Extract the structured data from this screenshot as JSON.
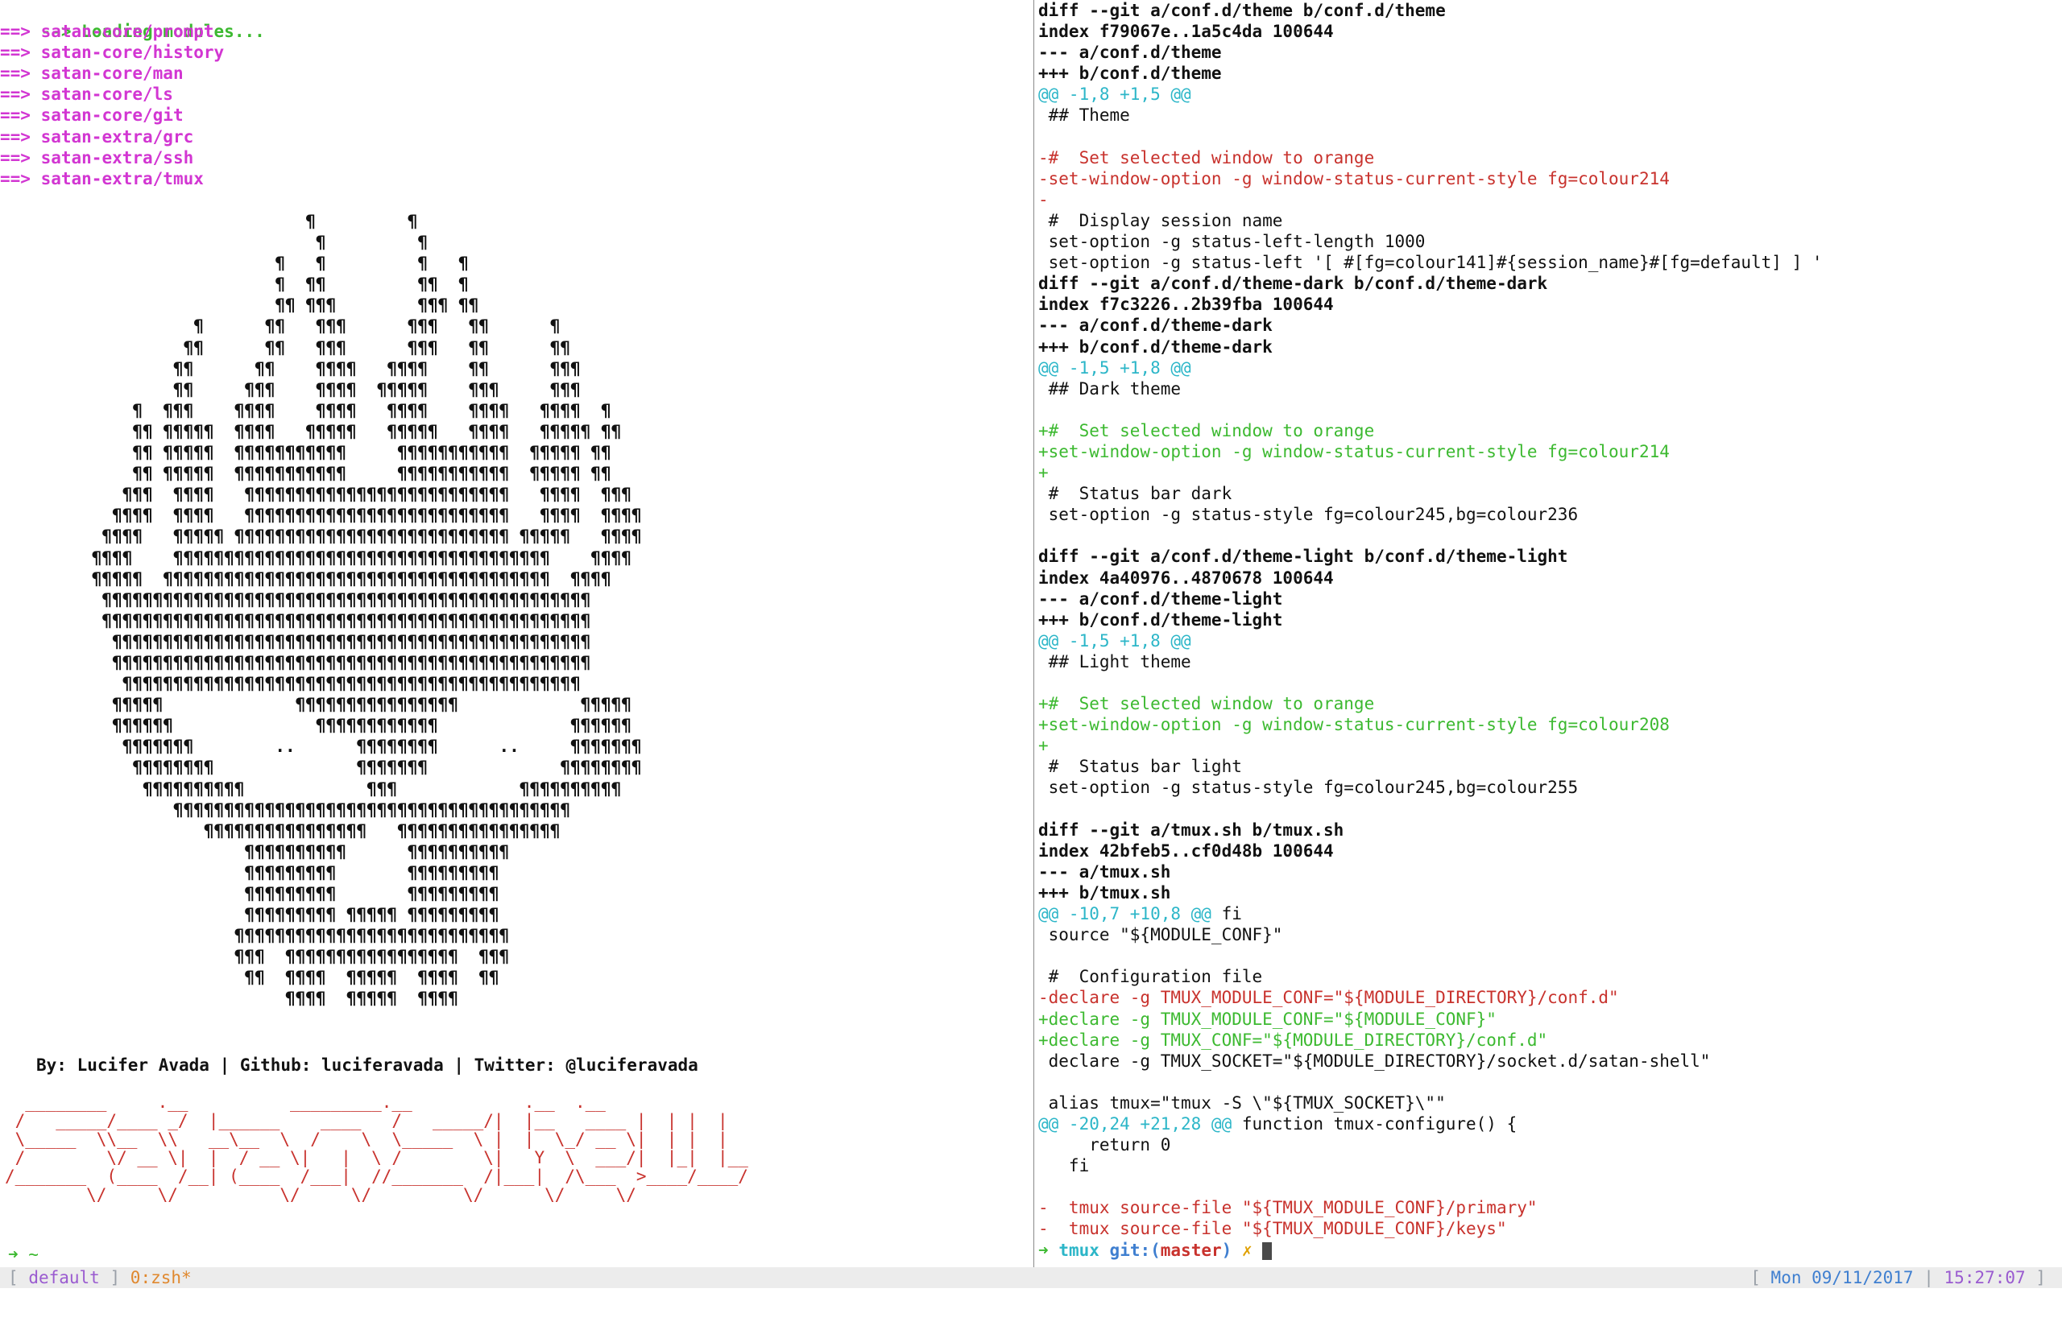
{
  "left_pane": {
    "loading": {
      "arrow": "-->",
      "text": "Loading modules..."
    },
    "modules": [
      {
        "arrow": "==>",
        "name": "satan-core/prompt"
      },
      {
        "arrow": "==>",
        "name": "satan-core/history"
      },
      {
        "arrow": "==>",
        "name": "satan-core/man"
      },
      {
        "arrow": "==>",
        "name": "satan-core/ls"
      },
      {
        "arrow": "==>",
        "name": "satan-core/git"
      },
      {
        "arrow": "==>",
        "name": "satan-extra/grc"
      },
      {
        "arrow": "==>",
        "name": "satan-extra/ssh"
      },
      {
        "arrow": "==>",
        "name": "satan-extra/tmux"
      }
    ],
    "ascii_art": [
      "                              ¶         ¶",
      "                               ¶         ¶",
      "                           ¶   ¶         ¶   ¶",
      "                           ¶  ¶¶         ¶¶  ¶",
      "                           ¶¶ ¶¶¶        ¶¶¶ ¶¶",
      "                   ¶      ¶¶   ¶¶¶      ¶¶¶   ¶¶      ¶",
      "                  ¶¶      ¶¶   ¶¶¶      ¶¶¶   ¶¶      ¶¶",
      "                 ¶¶      ¶¶    ¶¶¶¶   ¶¶¶¶    ¶¶      ¶¶¶",
      "                 ¶¶     ¶¶¶    ¶¶¶¶  ¶¶¶¶¶    ¶¶¶     ¶¶¶",
      "             ¶  ¶¶¶    ¶¶¶¶    ¶¶¶¶   ¶¶¶¶    ¶¶¶¶   ¶¶¶¶  ¶",
      "             ¶¶ ¶¶¶¶¶  ¶¶¶¶   ¶¶¶¶¶   ¶¶¶¶¶   ¶¶¶¶   ¶¶¶¶¶ ¶¶",
      "             ¶¶ ¶¶¶¶¶  ¶¶¶¶¶¶¶¶¶¶¶     ¶¶¶¶¶¶¶¶¶¶¶  ¶¶¶¶¶ ¶¶",
      "             ¶¶ ¶¶¶¶¶  ¶¶¶¶¶¶¶¶¶¶¶     ¶¶¶¶¶¶¶¶¶¶¶  ¶¶¶¶¶ ¶¶",
      "            ¶¶¶  ¶¶¶¶   ¶¶¶¶¶¶¶¶¶¶¶¶¶¶¶¶¶¶¶¶¶¶¶¶¶¶   ¶¶¶¶  ¶¶¶",
      "           ¶¶¶¶  ¶¶¶¶   ¶¶¶¶¶¶¶¶¶¶¶¶¶¶¶¶¶¶¶¶¶¶¶¶¶¶   ¶¶¶¶  ¶¶¶¶",
      "          ¶¶¶¶   ¶¶¶¶¶ ¶¶¶¶¶¶¶¶¶¶¶¶¶¶¶¶¶¶¶¶¶¶¶¶¶¶¶ ¶¶¶¶¶   ¶¶¶¶",
      "         ¶¶¶¶    ¶¶¶¶¶¶¶¶¶¶¶¶¶¶¶¶¶¶¶¶¶¶¶¶¶¶¶¶¶¶¶¶¶¶¶¶¶    ¶¶¶¶",
      "         ¶¶¶¶¶  ¶¶¶¶¶¶¶¶¶¶¶¶¶¶¶¶¶¶¶¶¶¶¶¶¶¶¶¶¶¶¶¶¶¶¶¶¶¶  ¶¶¶¶",
      "          ¶¶¶¶¶¶¶¶¶¶¶¶¶¶¶¶¶¶¶¶¶¶¶¶¶¶¶¶¶¶¶¶¶¶¶¶¶¶¶¶¶¶¶¶¶¶¶¶",
      "          ¶¶¶¶¶¶¶¶¶¶¶¶¶¶¶¶¶¶¶¶¶¶¶¶¶¶¶¶¶¶¶¶¶¶¶¶¶¶¶¶¶¶¶¶¶¶¶¶",
      "           ¶¶¶¶¶¶¶¶¶¶¶¶¶¶¶¶¶¶¶¶¶¶¶¶¶¶¶¶¶¶¶¶¶¶¶¶¶¶¶¶¶¶¶¶¶¶¶",
      "           ¶¶¶¶¶¶¶¶¶¶¶¶¶¶¶¶¶¶¶¶¶¶¶¶¶¶¶¶¶¶¶¶¶¶¶¶¶¶¶¶¶¶¶¶¶¶¶",
      "            ¶¶¶¶¶¶¶¶¶¶¶¶¶¶¶¶¶¶¶¶¶¶¶¶¶¶¶¶¶¶¶¶¶¶¶¶¶¶¶¶¶¶¶¶¶",
      "           ¶¶¶¶¶             ¶¶¶¶¶¶¶¶¶¶¶¶¶¶¶¶            ¶¶¶¶¶",
      "           ¶¶¶¶¶¶              ¶¶¶¶¶¶¶¶¶¶¶¶             ¶¶¶¶¶¶",
      "            ¶¶¶¶¶¶¶        ..      ¶¶¶¶¶¶¶¶      ..     ¶¶¶¶¶¶¶",
      "             ¶¶¶¶¶¶¶¶              ¶¶¶¶¶¶¶             ¶¶¶¶¶¶¶¶",
      "              ¶¶¶¶¶¶¶¶¶¶            ¶¶¶            ¶¶¶¶¶¶¶¶¶¶",
      "                 ¶¶¶¶¶¶¶¶¶¶¶¶¶¶¶¶¶¶¶¶¶¶¶¶¶¶¶¶¶¶¶¶¶¶¶¶¶¶¶",
      "                    ¶¶¶¶¶¶¶¶¶¶¶¶¶¶¶¶   ¶¶¶¶¶¶¶¶¶¶¶¶¶¶¶¶",
      "                        ¶¶¶¶¶¶¶¶¶¶      ¶¶¶¶¶¶¶¶¶¶",
      "                        ¶¶¶¶¶¶¶¶¶       ¶¶¶¶¶¶¶¶¶",
      "                        ¶¶¶¶¶¶¶¶¶       ¶¶¶¶¶¶¶¶¶",
      "                        ¶¶¶¶¶¶¶¶¶ ¶¶¶¶¶ ¶¶¶¶¶¶¶¶¶",
      "                       ¶¶¶¶¶¶¶¶¶¶¶¶¶¶¶¶¶¶¶¶¶¶¶¶¶¶¶",
      "                       ¶¶¶  ¶¶¶¶¶¶¶¶¶¶¶¶¶¶¶¶¶  ¶¶¶",
      "                        ¶¶  ¶¶¶¶  ¶¶¶¶¶  ¶¶¶¶  ¶¶",
      "                            ¶¶¶¶  ¶¶¶¶¶  ¶¶¶¶"
    ],
    "byline": "By: Lucifer Avada | Github: luciferavada | Twitter: @luciferavada",
    "banner": [
      "  ________     .__          _________.__           .__  .__",
      " /   _____/____ _/  |______    ____   /   _____/|  |__   ____ |  | |  |",
      " \\_____  \\\\__  \\\\   __\\__  \\  /    \\  \\_____  \\ |  |  \\_/ __ \\|  | |  |",
      " /        \\/ __ \\|  |  / __ \\|   |  \\ /        \\|   Y  \\  ___/|  |_|  |__",
      "/_______  (____  /__| (____  /___|  //_______  /|___|  /\\___  >____/____/",
      "        \\/     \\/          \\/     \\/         \\/      \\/     \\/"
    ],
    "prompt": "➜ ~"
  },
  "right_pane": {
    "diff_lines": [
      {
        "t": "diff --git a/conf.d/theme b/conf.d/theme",
        "k": "h"
      },
      {
        "t": "index f79067e..1a5c4da 100644",
        "k": "h"
      },
      {
        "t": "--- a/conf.d/theme",
        "k": "h"
      },
      {
        "t": "+++ b/conf.d/theme",
        "k": "h"
      },
      {
        "t": "@@ -1,8 +1,5 @@",
        "k": "hunk"
      },
      {
        "t": " ## Theme",
        "k": "ctx"
      },
      {
        "t": "",
        "k": "ctx"
      },
      {
        "t": "-#  Set selected window to orange",
        "k": "del"
      },
      {
        "t": "-set-window-option -g window-status-current-style fg=colour214",
        "k": "del"
      },
      {
        "t": "-",
        "k": "del"
      },
      {
        "t": " #  Display session name",
        "k": "ctx"
      },
      {
        "t": " set-option -g status-left-length 1000",
        "k": "ctx"
      },
      {
        "t": " set-option -g status-left '[ #[fg=colour141]#{session_name}#[fg=default] ] '",
        "k": "ctx"
      },
      {
        "t": "diff --git a/conf.d/theme-dark b/conf.d/theme-dark",
        "k": "h"
      },
      {
        "t": "index f7c3226..2b39fba 100644",
        "k": "h"
      },
      {
        "t": "--- a/conf.d/theme-dark",
        "k": "h"
      },
      {
        "t": "+++ b/conf.d/theme-dark",
        "k": "h"
      },
      {
        "t": "@@ -1,5 +1,8 @@",
        "k": "hunk"
      },
      {
        "t": " ## Dark theme",
        "k": "ctx"
      },
      {
        "t": "",
        "k": "ctx"
      },
      {
        "t": "+#  Set selected window to orange",
        "k": "add"
      },
      {
        "t": "+set-window-option -g window-status-current-style fg=colour214",
        "k": "add"
      },
      {
        "t": "+",
        "k": "add"
      },
      {
        "t": " #  Status bar dark",
        "k": "ctx"
      },
      {
        "t": " set-option -g status-style fg=colour245,bg=colour236",
        "k": "ctx"
      },
      {
        "t": "",
        "k": "ctx"
      },
      {
        "t": "diff --git a/conf.d/theme-light b/conf.d/theme-light",
        "k": "h"
      },
      {
        "t": "index 4a40976..4870678 100644",
        "k": "h"
      },
      {
        "t": "--- a/conf.d/theme-light",
        "k": "h"
      },
      {
        "t": "+++ b/conf.d/theme-light",
        "k": "h"
      },
      {
        "t": "@@ -1,5 +1,8 @@",
        "k": "hunk"
      },
      {
        "t": " ## Light theme",
        "k": "ctx"
      },
      {
        "t": "",
        "k": "ctx"
      },
      {
        "t": "+#  Set selected window to orange",
        "k": "add"
      },
      {
        "t": "+set-window-option -g window-status-current-style fg=colour208",
        "k": "add"
      },
      {
        "t": "+",
        "k": "add"
      },
      {
        "t": " #  Status bar light",
        "k": "ctx"
      },
      {
        "t": " set-option -g status-style fg=colour245,bg=colour255",
        "k": "ctx"
      },
      {
        "t": "",
        "k": "ctx"
      },
      {
        "t": "diff --git a/tmux.sh b/tmux.sh",
        "k": "h"
      },
      {
        "t": "index 42bfeb5..cf0d48b 100644",
        "k": "h"
      },
      {
        "t": "--- a/tmux.sh",
        "k": "h"
      },
      {
        "t": "+++ b/tmux.sh",
        "k": "h"
      },
      {
        "t": "@@ -10,7 +10,8 @@",
        "k": "hunk",
        "tail": " fi"
      },
      {
        "t": " source \"${MODULE_CONF}\"",
        "k": "ctx"
      },
      {
        "t": "",
        "k": "ctx"
      },
      {
        "t": " #  Configuration file",
        "k": "ctx"
      },
      {
        "t": "-declare -g TMUX_MODULE_CONF=\"${MODULE_DIRECTORY}/conf.d\"",
        "k": "del"
      },
      {
        "t": "+declare -g TMUX_MODULE_CONF=\"${MODULE_CONF}\"",
        "k": "add"
      },
      {
        "t": "+declare -g TMUX_CONF=\"${MODULE_DIRECTORY}/conf.d\"",
        "k": "add"
      },
      {
        "t": " declare -g TMUX_SOCKET=\"${MODULE_DIRECTORY}/socket.d/satan-shell\"",
        "k": "ctx"
      },
      {
        "t": "",
        "k": "ctx"
      },
      {
        "t": " alias tmux=\"tmux -S \\\"${TMUX_SOCKET}\\\"\"",
        "k": "ctx"
      },
      {
        "t": "@@ -20,24 +21,28 @@",
        "k": "hunk",
        "tail": " function tmux-configure() {"
      },
      {
        "t": "     return 0",
        "k": "ctx"
      },
      {
        "t": "   fi",
        "k": "ctx"
      },
      {
        "t": "",
        "k": "ctx"
      },
      {
        "t": "-  tmux source-file \"${TMUX_MODULE_CONF}/primary\"",
        "k": "del"
      },
      {
        "t": "-  tmux source-file \"${TMUX_MODULE_CONF}/keys\"",
        "k": "del"
      }
    ],
    "prompt": {
      "arrow": "➜",
      "dir": "tmux",
      "git_label": "git:(",
      "branch": "master",
      "git_close": ")",
      "dirty": "✗"
    }
  },
  "status_bar": {
    "session_open": "[",
    "session": "default",
    "session_close": "]",
    "window": "0:zsh*",
    "right_open": "[",
    "date": "Mon 09/11/2017",
    "sep": "|",
    "time": "15:27:07",
    "right_close": "]"
  },
  "colors": {
    "green": "#3cb930",
    "magenta": "#d236d2",
    "red": "#c8322d",
    "cyan": "#2cb6c8"
  }
}
